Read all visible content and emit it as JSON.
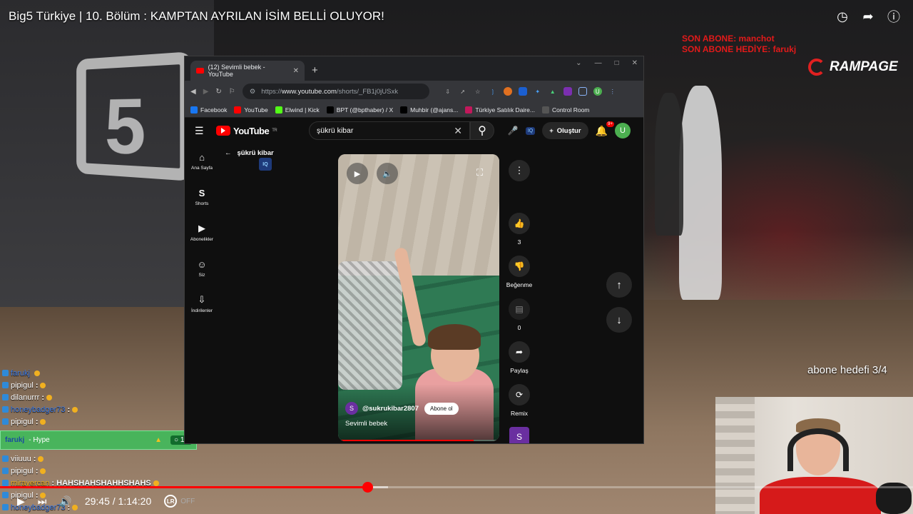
{
  "stream": {
    "video_title": "Big5 Türkiye | 10. Bölüm : KAMPTAN AYRILAN İSİM BELLİ OLUYOR!",
    "last_sub": "SON ABONE: manchot",
    "last_gift": "SON ABONE HEDİYE: farukj",
    "brand": "RAMPAGE",
    "sub_goal": "abone hedefi 3/4",
    "studio_logo": "5"
  },
  "chat": [
    {
      "user": "farukj",
      "msg": "",
      "user_color": "#3b7be8"
    },
    {
      "user": "pipigul",
      "msg": ":",
      "user_color": "#ffffff"
    },
    {
      "user": "dilanurrr",
      "msg": ":",
      "user_color": "#ffffff"
    },
    {
      "user": "honeybadger73",
      "msg": ":",
      "user_color": "#3b7be8"
    },
    {
      "user": "pipigul",
      "msg": ":",
      "user_color": "#ffffff"
    }
  ],
  "chat_after": [
    {
      "user": "viiuuu",
      "msg": ":",
      "user_color": "#ffffff"
    },
    {
      "user": "pipigul",
      "msg": ":",
      "user_color": "#ffffff"
    },
    {
      "user": "mirayercan",
      "msg": ": HAHSHAHSHAHHSHAHS",
      "user_color": "#f0b020"
    },
    {
      "user": "pipigul",
      "msg": ":",
      "user_color": "#ffffff"
    },
    {
      "user": "honeybadger73",
      "msg": ":",
      "user_color": "#3b7be8"
    }
  ],
  "hype": {
    "user": "farukj",
    "label": "- Hype",
    "count": "10"
  },
  "player": {
    "time": "29:45 / 1:14:20",
    "ext_label": "OFF",
    "progress_played": 0.402,
    "progress_loaded": 0.425
  },
  "browser": {
    "tab_title": "(12) Sevimli bebek - YouTube",
    "url_prefix": "https://",
    "url_domain": "www.youtube.com",
    "url_path": "/shorts/_FB1j0jUSxk",
    "bookmarks": [
      "Facebook",
      "YouTube",
      "Elwind | Kick",
      "BPT (@bpthaber) / X",
      "Muhbir (@ajans...",
      "Türkiye Satılık Daire...",
      "Control Room"
    ]
  },
  "youtube": {
    "logo": "YouTube",
    "region": "TR",
    "search_value": "şükrü kibar",
    "create_label": "Oluştur",
    "notif_count": "9+",
    "avatar_letter": "U",
    "nav": [
      "Ana Sayfa",
      "Shorts",
      "Abonelikler",
      "Siz",
      "İndirilenler"
    ],
    "back_query": "şükrü kibar",
    "iq_label": "IQ",
    "short": {
      "channel": "@sukrukibar2807",
      "channel_letter": "S",
      "subscribe": "Abone ol",
      "title": "Sevimli bebek",
      "progress": 0.84
    },
    "likes": "3",
    "dislike_label": "Beğenme",
    "comments": "0",
    "share_label": "Paylaş",
    "remix_label": "Remix",
    "avatar_sq": "S"
  }
}
